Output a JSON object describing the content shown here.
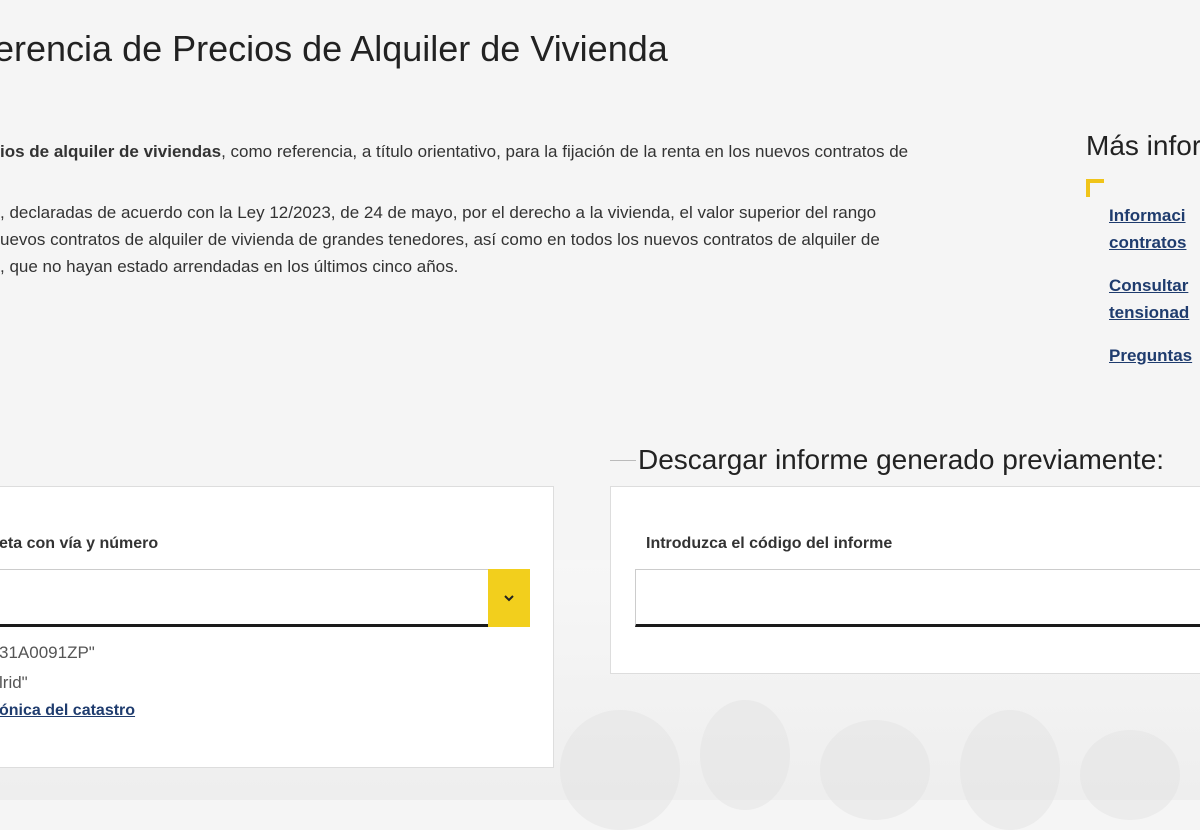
{
  "page": {
    "title": "erencia de Precios de Alquiler de Vivienda"
  },
  "intro": {
    "p1_bold": "ios de alquiler de viviendas",
    "p1_rest": ", como referencia, a título orientativo, para la fijación de la renta en los nuevos contratos de",
    "p2_line1": ", declaradas de acuerdo con la Ley 12/2023, de 24 de mayo, por el derecho a la vivienda, el valor superior del rango",
    "p2_line2": "uevos contratos de alquiler de vivienda de grandes tenedores, así como en todos los nuevos contratos de alquiler de",
    "p2_line3": ", que no hayan estado arrendadas en los últimos cinco años."
  },
  "sidebar": {
    "title": "Más infor",
    "links": [
      {
        "line1": "Informaci",
        "line2": "contratos"
      },
      {
        "line1": "Consultar",
        "line2": "tensionad"
      },
      {
        "line1": "Preguntas",
        "line2": ""
      }
    ]
  },
  "search_card": {
    "label": "eta con vía y número",
    "input_value": "",
    "example_1": "31A0091ZP\"",
    "example_2": "lrid\"",
    "catastro_link": "ónica del catastro",
    "dropdown_icon": "chevron-down-icon"
  },
  "download_section": {
    "legend": "Descargar informe generado previamente:",
    "label": "Introduzca el código del informe",
    "input_value": ""
  },
  "colors": {
    "accent_yellow": "#f2cf1d",
    "link_blue": "#1f3c6e",
    "background": "#f5f5f5"
  }
}
